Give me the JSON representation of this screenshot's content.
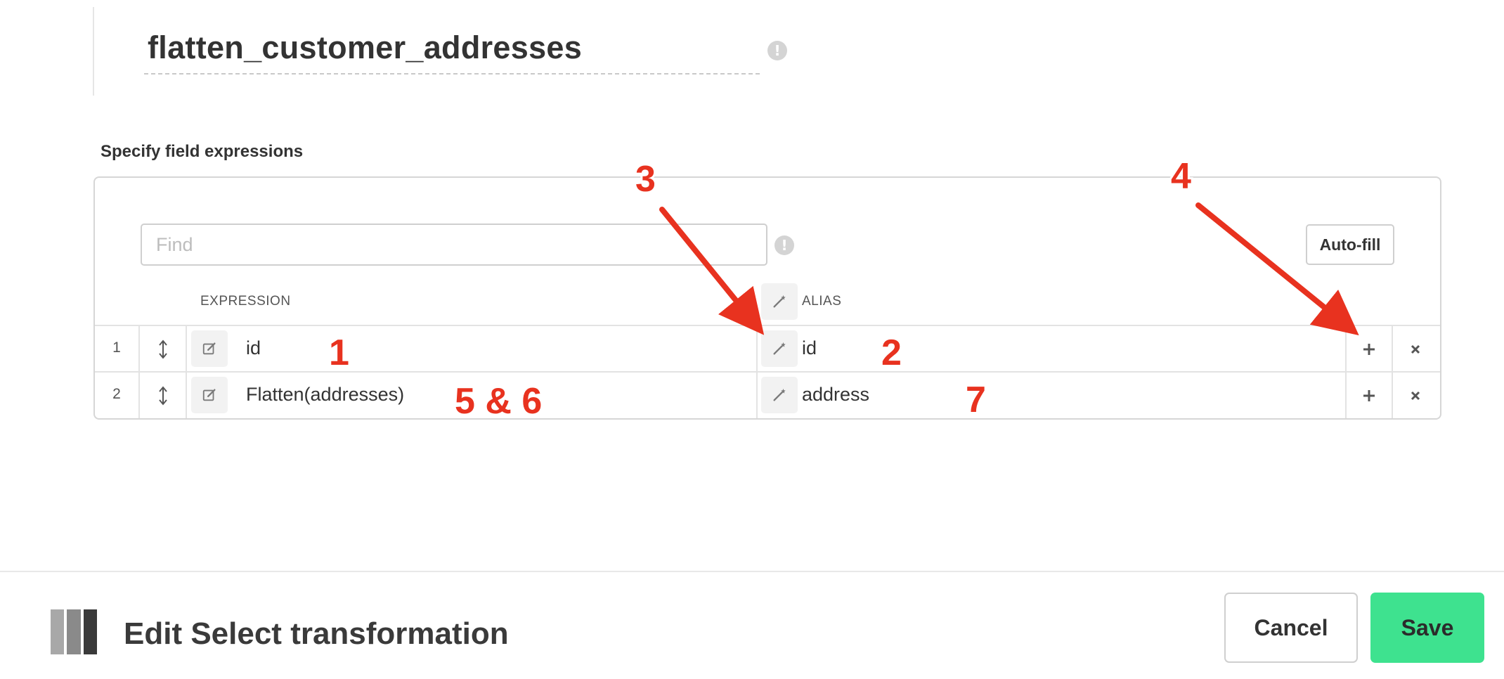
{
  "transformation": {
    "name": "flatten_customer_addresses",
    "info_glyph": "!"
  },
  "fields": {
    "section_title": "Specify field expressions",
    "find_placeholder": "Find",
    "find_value": "",
    "autofill_label": "Auto-fill",
    "headers": {
      "expression": "EXPRESSION",
      "alias": "ALIAS"
    },
    "rows": [
      {
        "index": "1",
        "expression": "id",
        "alias": "id"
      },
      {
        "index": "2",
        "expression": "Flatten(addresses)",
        "alias": "address"
      }
    ]
  },
  "annotations": [
    {
      "label": "1"
    },
    {
      "label": "2"
    },
    {
      "label": "3"
    },
    {
      "label": "4"
    },
    {
      "label": "5 & 6"
    },
    {
      "label": "7"
    }
  ],
  "colors": {
    "annotation": "#e8321f",
    "save": "#3ee28f",
    "logo": [
      "#a8a8a8",
      "#8a8a8a",
      "#3a3a3a"
    ]
  },
  "icons": [
    "info-icon",
    "drag-handle-icon",
    "edit-icon",
    "magic-wand-icon",
    "plus-icon",
    "close-icon",
    "transform-logo-icon"
  ],
  "footer": {
    "title": "Edit Select transformation",
    "cancel_label": "Cancel",
    "save_label": "Save"
  }
}
